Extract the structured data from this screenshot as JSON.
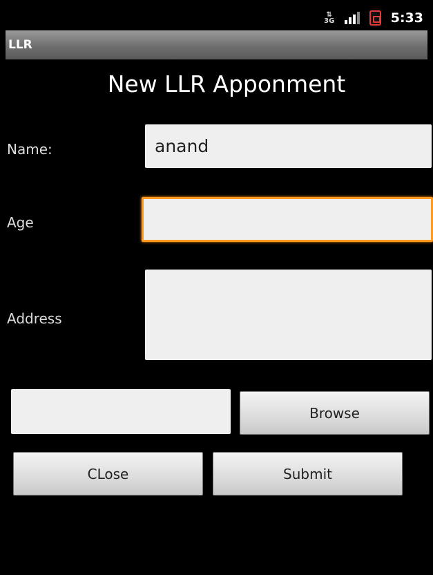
{
  "statusbar": {
    "network": "3G",
    "time": "5:33",
    "network_icon": "3g-icon",
    "signal_icon": "signal-icon",
    "battery_icon": "battery-icon",
    "battery_color": "#e23b3b"
  },
  "app": {
    "title": "LLR"
  },
  "form": {
    "heading": "New LLR Apponment",
    "name_label": "Name:",
    "name_value": "anand",
    "age_label": "Age",
    "age_value": "",
    "address_label": "Address",
    "address_value": "",
    "file_value": "",
    "browse_label": "Browse",
    "close_label": "CLose",
    "submit_label": "Submit",
    "focus_color": "#ff9a1e"
  }
}
